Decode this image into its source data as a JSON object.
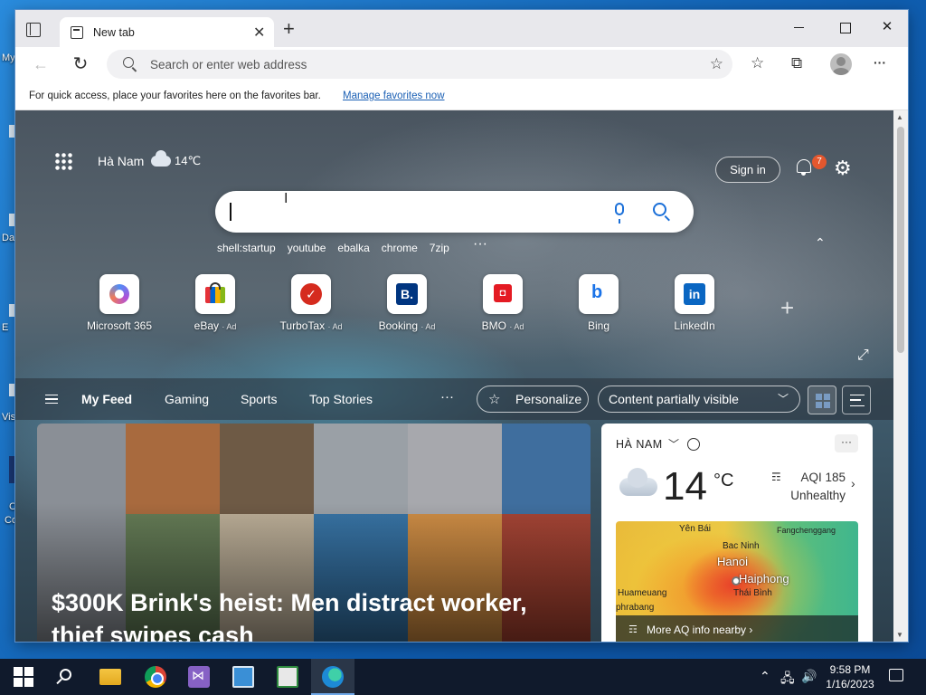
{
  "desktop": {
    "labels": [
      "My",
      "Da",
      "E",
      "Vis",
      "C",
      "Co"
    ]
  },
  "browser": {
    "tab": {
      "title": "New tab",
      "close": "✕"
    },
    "new_tab": "+",
    "window_controls": {
      "minimize": "",
      "maximize": "",
      "close": "✕"
    },
    "toolbar": {
      "back": "←",
      "refresh": "↻",
      "address_placeholder": "Search or enter web address",
      "add_favorite": "☆",
      "favorites": "☆",
      "collections": "⧉",
      "more": "···"
    },
    "favorites_bar": {
      "text": "For quick access, place your favorites here on the favorites bar.",
      "link": "Manage favorites now"
    }
  },
  "ntp": {
    "location": "Hà Nam",
    "temperature": "14℃",
    "sign_in": "Sign in",
    "notification_count": "7",
    "search_placeholder": "",
    "quick_links": [
      "shell:startup",
      "youtube",
      "ebalka",
      "chrome",
      "7zip"
    ],
    "quick_links_more": "···",
    "collapse": "⌃",
    "tiles": [
      {
        "label": "Microsoft 365",
        "ad": "",
        "icon": "microsoft365-icon",
        "color": "#7b5bd6"
      },
      {
        "label": "eBay",
        "ad": "· Ad",
        "icon": "ebay-icon",
        "color": "#e53238"
      },
      {
        "label": "TurboTax",
        "ad": "· Ad",
        "icon": "turbotax-icon",
        "color": "#d52b1e"
      },
      {
        "label": "Booking",
        "ad": "· Ad",
        "icon": "booking-icon",
        "color": "#003580"
      },
      {
        "label": "BMO",
        "ad": "· Ad",
        "icon": "bmo-icon",
        "color": "#e41b23"
      },
      {
        "label": "Bing",
        "ad": "",
        "icon": "bing-icon",
        "color": "#1a73e8"
      },
      {
        "label": "LinkedIn",
        "ad": "",
        "icon": "linkedin-icon",
        "color": "#0a66c2"
      }
    ],
    "add_tile": "+",
    "expand": "⤢",
    "feed": {
      "tabs": [
        "My Feed",
        "Gaming",
        "Sports",
        "Top Stories"
      ],
      "more": "···",
      "personalize": "Personalize",
      "content_visibility": "Content partially visible"
    },
    "hero": {
      "title": "$300K Brink's heist: Men distract worker, thief swipes cash"
    },
    "weather_card": {
      "location": "HÀ NAM",
      "more": "···",
      "temperature": "14",
      "unit": "°C",
      "aqi": "AQI 185",
      "aqi_status": "Unhealthy",
      "map_labels": {
        "yen_bai": "Yên Bái",
        "fangchenggang": "Fangchenggang",
        "bac_ninh": "Bac Ninh",
        "hanoi": "Hanoi",
        "haiphong": "Haiphong",
        "huameuang": "Huameuang",
        "thai_binh": "Thái Bình",
        "phrabang": "phrabang"
      },
      "more_aq": "More AQ info nearby ›"
    }
  },
  "taskbar": {
    "tray_chevron": "⌃",
    "time": "9:58 PM",
    "date": "1/16/2023"
  }
}
